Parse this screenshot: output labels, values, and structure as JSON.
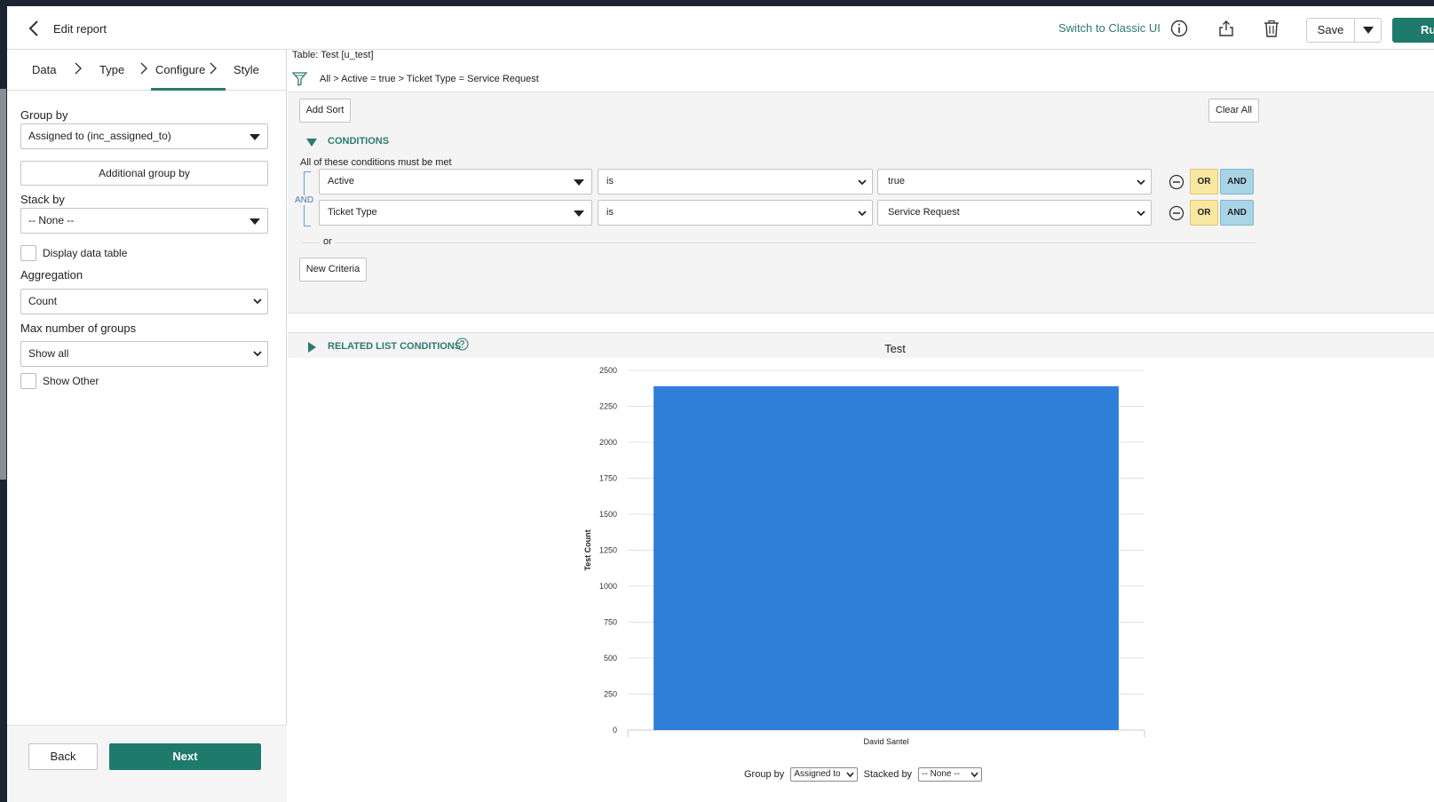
{
  "header": {
    "title": "Edit report",
    "switch_label": "Switch to Classic UI",
    "save_label": "Save",
    "run_label": "Ru"
  },
  "steps": {
    "data": "Data",
    "type": "Type",
    "configure": "Configure",
    "style": "Style"
  },
  "config": {
    "group_by_label": "Group by",
    "group_by_value": "Assigned to (inc_assigned_to)",
    "additional_group_by": "Additional group by",
    "stack_by_label": "Stack by",
    "stack_by_value": "-- None --",
    "display_data_table": "Display data table",
    "aggregation_label": "Aggregation",
    "aggregation_value": "Count",
    "max_groups_label": "Max number of groups",
    "max_groups_value": "Show all",
    "show_other": "Show Other",
    "back_label": "Back",
    "next_label": "Next"
  },
  "filter": {
    "table_name": "Table: Test [u_test]",
    "breadcrumb": "All  >  Active = true  >  Ticket Type = Service Request",
    "add_sort": "Add Sort",
    "clear_all": "Clear All",
    "conditions_header": "CONDITIONS",
    "conditions_label": "All of these conditions must be met",
    "and_label": "AND",
    "or_label": "or",
    "new_criteria": "New Criteria",
    "related_header": "RELATED LIST CONDITIONS",
    "rows": [
      {
        "field": "Active",
        "operator": "is",
        "value": "true",
        "or": "OR",
        "and": "AND"
      },
      {
        "field": "Ticket Type",
        "operator": "is",
        "value": "Service Request",
        "or": "OR",
        "and": "AND"
      }
    ]
  },
  "chart_data": {
    "type": "bar",
    "title": "Test",
    "xlabel": "",
    "ylabel": "Test Count",
    "categories": [
      "David Santel"
    ],
    "values": [
      2390
    ],
    "ylim": [
      0,
      2500
    ],
    "yticks": [
      0,
      250,
      500,
      750,
      1000,
      1250,
      1500,
      1750,
      2000,
      2250,
      2500
    ],
    "bar_color": "#2f7fd9",
    "grid": true
  },
  "chart_controls": {
    "group_by_label": "Group by",
    "group_by_value": "Assigned to",
    "stacked_by_label": "Stacked by",
    "stacked_by_value": "-- None --"
  },
  "colors": {
    "accent": "#1e7a6a",
    "link": "#2c7a6e"
  }
}
